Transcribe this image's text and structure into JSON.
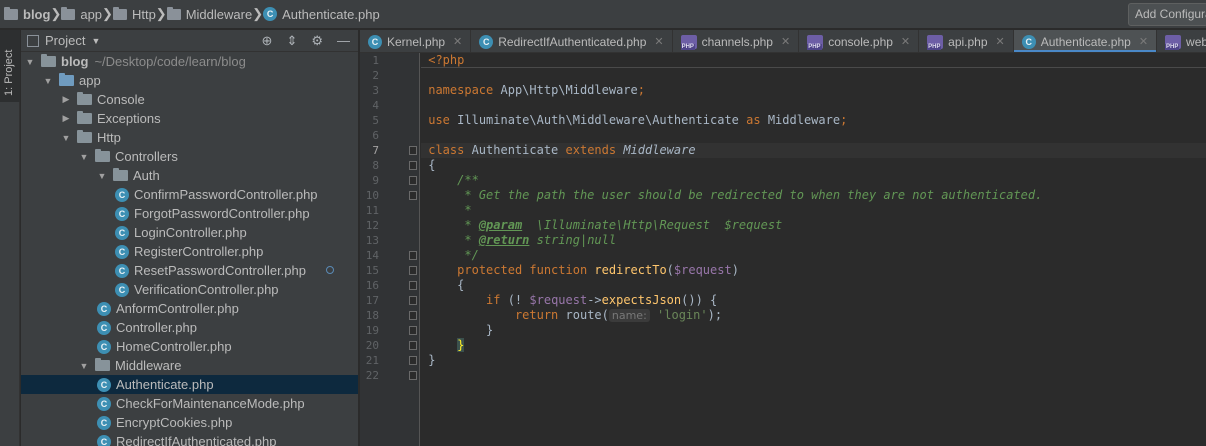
{
  "breadcrumb": [
    "blog",
    "app",
    "Http",
    "Middleware",
    "Authenticate.php"
  ],
  "run_config_button": "Add Configura",
  "toolwindow_strip_label": "1: Project",
  "project_panel": {
    "title": "Project",
    "tree": [
      {
        "label": "blog",
        "suffix": "~/Desktop/code/learn/blog",
        "type": "folder",
        "depth": 0,
        "expanded": true,
        "bold": true
      },
      {
        "label": "app",
        "type": "folder-blue",
        "depth": 1,
        "expanded": true
      },
      {
        "label": "Console",
        "type": "folder",
        "depth": 2,
        "expanded": false
      },
      {
        "label": "Exceptions",
        "type": "folder",
        "depth": 2,
        "expanded": false
      },
      {
        "label": "Http",
        "type": "folder",
        "depth": 2,
        "expanded": true
      },
      {
        "label": "Controllers",
        "type": "folder",
        "depth": 3,
        "expanded": true
      },
      {
        "label": "Auth",
        "type": "folder",
        "depth": 4,
        "expanded": true
      },
      {
        "label": "ConfirmPasswordController.php",
        "type": "class",
        "depth": 5
      },
      {
        "label": "ForgotPasswordController.php",
        "type": "class",
        "depth": 5
      },
      {
        "label": "LoginController.php",
        "type": "class",
        "depth": 5
      },
      {
        "label": "RegisterController.php",
        "type": "class",
        "depth": 5
      },
      {
        "label": "ResetPasswordController.php",
        "type": "class",
        "depth": 5
      },
      {
        "label": "VerificationController.php",
        "type": "class",
        "depth": 5
      },
      {
        "label": "AnformController.php",
        "type": "class",
        "depth": 4
      },
      {
        "label": "Controller.php",
        "type": "class",
        "depth": 4
      },
      {
        "label": "HomeController.php",
        "type": "class",
        "depth": 4
      },
      {
        "label": "Middleware",
        "type": "folder",
        "depth": 3,
        "expanded": true
      },
      {
        "label": "Authenticate.php",
        "type": "class",
        "depth": 4,
        "selected": true
      },
      {
        "label": "CheckForMaintenanceMode.php",
        "type": "class",
        "depth": 4
      },
      {
        "label": "EncryptCookies.php",
        "type": "class",
        "depth": 4
      },
      {
        "label": "RedirectIfAuthenticated.php",
        "type": "class",
        "depth": 4
      }
    ]
  },
  "editor_tabs": [
    {
      "label": "Kernel.php",
      "icon": "class",
      "active": false
    },
    {
      "label": "RedirectIfAuthenticated.php",
      "icon": "class",
      "active": false
    },
    {
      "label": "channels.php",
      "icon": "php",
      "active": false
    },
    {
      "label": "console.php",
      "icon": "php",
      "active": false
    },
    {
      "label": "api.php",
      "icon": "php",
      "active": false
    },
    {
      "label": "Authenticate.php",
      "icon": "class",
      "active": true
    },
    {
      "label": "web.php",
      "icon": "php",
      "active": false
    }
  ],
  "current_line": 7,
  "code_lines": [
    [
      [
        "tag",
        "<?php"
      ]
    ],
    [],
    [
      [
        "kw",
        "namespace"
      ],
      [
        "",
        " App\\Http\\Middleware"
      ],
      [
        "kw",
        ";"
      ]
    ],
    [],
    [
      [
        "kw",
        "use"
      ],
      [
        "",
        " Illuminate\\Auth\\Middleware\\Authenticate "
      ],
      [
        "kw",
        "as"
      ],
      [
        "",
        " Middleware"
      ],
      [
        "kw",
        ";"
      ]
    ],
    [],
    [
      [
        "kw",
        "class"
      ],
      [
        "",
        " Authenticate "
      ],
      [
        "kw",
        "extends"
      ],
      [
        "",
        " "
      ],
      [
        "itl",
        "Middleware"
      ]
    ],
    [
      [
        "",
        "{"
      ]
    ],
    [
      [
        "",
        "    "
      ],
      [
        "doc",
        "/**"
      ]
    ],
    [
      [
        "",
        "    "
      ],
      [
        "doc",
        " * Get the path the user should be redirected to when they are not authenticated."
      ]
    ],
    [
      [
        "",
        "    "
      ],
      [
        "doc",
        " *"
      ]
    ],
    [
      [
        "",
        "    "
      ],
      [
        "doc",
        " * "
      ],
      [
        "doctag",
        "@param"
      ],
      [
        "doc",
        "  \\Illuminate\\Http\\Request  $request"
      ]
    ],
    [
      [
        "",
        "    "
      ],
      [
        "doc",
        " * "
      ],
      [
        "doctag",
        "@return"
      ],
      [
        "doc",
        " string|null"
      ]
    ],
    [
      [
        "",
        "    "
      ],
      [
        "doc",
        " */"
      ]
    ],
    [
      [
        "",
        "    "
      ],
      [
        "kw",
        "protected function "
      ],
      [
        "fn",
        "redirectTo"
      ],
      [
        "",
        "("
      ],
      [
        "var",
        "$request"
      ],
      [
        "",
        ")"
      ]
    ],
    [
      [
        "",
        "    {"
      ]
    ],
    [
      [
        "",
        "        "
      ],
      [
        "kw",
        "if"
      ],
      [
        "",
        " (! "
      ],
      [
        "var",
        "$request"
      ],
      [
        "",
        "->"
      ],
      [
        "fn",
        "expectsJson"
      ],
      [
        "",
        "()) {"
      ]
    ],
    [
      [
        "",
        "            "
      ],
      [
        "kw",
        "return"
      ],
      [
        "",
        " route("
      ],
      [
        "hint",
        "name:"
      ],
      [
        "",
        " "
      ],
      [
        "str",
        "'login'"
      ],
      [
        "",
        ");"
      ]
    ],
    [
      [
        "",
        "        }"
      ]
    ],
    [
      [
        "",
        "    "
      ],
      [
        "bracehl",
        "}"
      ]
    ],
    [
      [
        "",
        "}"
      ]
    ],
    []
  ]
}
